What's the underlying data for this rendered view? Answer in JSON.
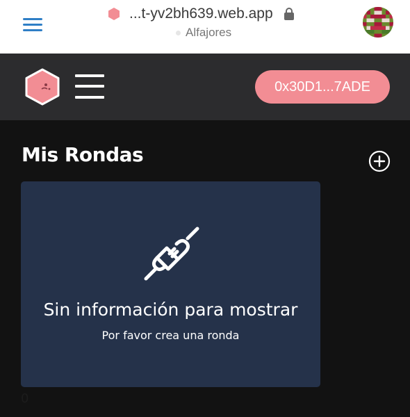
{
  "browser": {
    "url": "...t-yv2bh639.web.app",
    "network": "Alfajores",
    "icons": {
      "menu": "hamburger-menu-icon",
      "favicon": "pink-hexagon-icon",
      "lock": "lock-icon",
      "account": "identicon-avatar"
    },
    "accent_color": "#2f7fc6"
  },
  "header": {
    "account_label": "0x30D1...7ADE",
    "button_color": "#f28d94",
    "icons": {
      "logo": "pink-hexagon-logo",
      "menu": "hamburger-menu-icon"
    }
  },
  "main": {
    "title": "Mis Rondas",
    "add_icon": "add-circle-icon",
    "empty_state": {
      "icon": "plug-icon",
      "title": "Sin información para mostrar",
      "subtitle": "Por favor crea una ronda"
    },
    "count": "0"
  }
}
